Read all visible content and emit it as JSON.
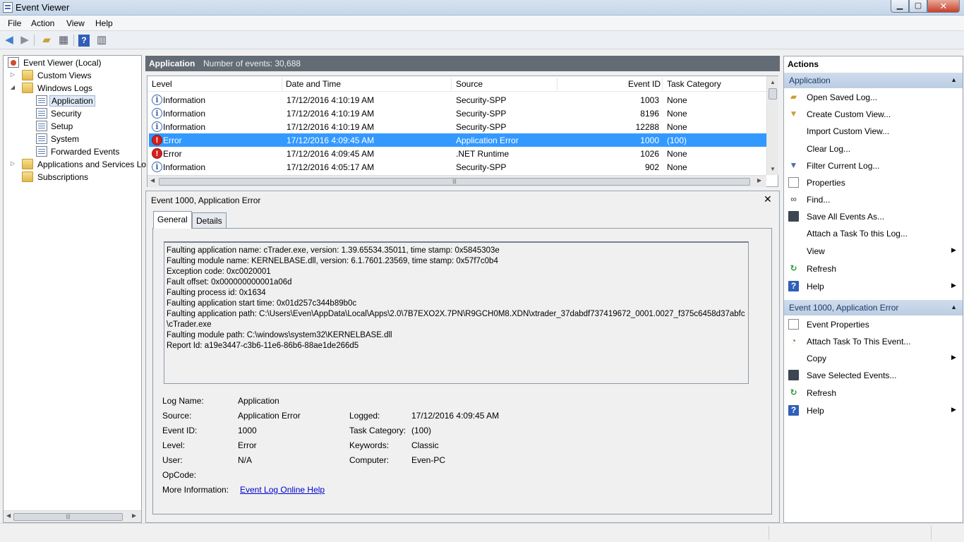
{
  "window": {
    "title": "Event Viewer"
  },
  "menu": [
    "File",
    "Action",
    "View",
    "Help"
  ],
  "tree": {
    "root": "Event Viewer (Local)",
    "custom_views": "Custom Views",
    "windows_logs": "Windows Logs",
    "logs": [
      "Application",
      "Security",
      "Setup",
      "System",
      "Forwarded Events"
    ],
    "apps_services": "Applications and Services Lo",
    "subscriptions": "Subscriptions"
  },
  "center": {
    "title": "Application",
    "count": "Number of events: 30,688"
  },
  "columns": [
    "Level",
    "Date and Time",
    "Source",
    "Event ID",
    "Task Category"
  ],
  "events": [
    {
      "level": "Information",
      "date": "17/12/2016 4:10:19 AM",
      "source": "Security-SPP",
      "id": "1003",
      "task": "None"
    },
    {
      "level": "Information",
      "date": "17/12/2016 4:10:19 AM",
      "source": "Security-SPP",
      "id": "8196",
      "task": "None"
    },
    {
      "level": "Information",
      "date": "17/12/2016 4:10:19 AM",
      "source": "Security-SPP",
      "id": "12288",
      "task": "None"
    },
    {
      "level": "Error",
      "date": "17/12/2016 4:09:45 AM",
      "source": "Application Error",
      "id": "1000",
      "task": "(100)"
    },
    {
      "level": "Error",
      "date": "17/12/2016 4:09:45 AM",
      "source": ".NET Runtime",
      "id": "1026",
      "task": "None"
    },
    {
      "level": "Information",
      "date": "17/12/2016 4:05:17 AM",
      "source": "Security-SPP",
      "id": "902",
      "task": "None"
    }
  ],
  "detail": {
    "title": "Event 1000, Application Error",
    "tabs": [
      "General",
      "Details"
    ],
    "message": [
      "Faulting application name: cTrader.exe, version: 1.39.65534.35011, time stamp: 0x5845303e",
      "Faulting module name: KERNELBASE.dll, version: 6.1.7601.23569, time stamp: 0x57f7c0b4",
      "Exception code: 0xc0020001",
      "Fault offset: 0x000000000001a06d",
      "Faulting process id: 0x1634",
      "Faulting application start time: 0x01d257c344b89b0c",
      "Faulting application path: C:\\Users\\Even\\AppData\\Local\\Apps\\2.0\\7B7EXO2X.7PN\\R9GCH0M8.XDN\\xtrader_37dabdf737419672_0001.0027_f375c6458d37abfc",
      "\\cTrader.exe",
      "Faulting module path: C:\\windows\\system32\\KERNELBASE.dll",
      "Report Id: a19e3447-c3b6-11e6-86b6-88ae1de266d5"
    ],
    "props": {
      "log_name_label": "Log Name:",
      "log_name": "Application",
      "source_label": "Source:",
      "source": "Application Error",
      "logged_label": "Logged:",
      "logged": "17/12/2016 4:09:45 AM",
      "event_id_label": "Event ID:",
      "event_id": "1000",
      "task_label": "Task Category:",
      "task": "(100)",
      "level_label": "Level:",
      "level": "Error",
      "keywords_label": "Keywords:",
      "keywords": "Classic",
      "user_label": "User:",
      "user": "N/A",
      "computer_label": "Computer:",
      "computer": "Even-PC",
      "opcode_label": "OpCode:",
      "more_info_label": "More Information:",
      "more_info_link": "Event Log Online Help"
    }
  },
  "actions": {
    "header": "Actions",
    "section1": "Application",
    "items1": [
      {
        "label": "Open Saved Log...",
        "icon": "folder-open-icon"
      },
      {
        "label": "Create Custom View...",
        "icon": "filter-icon"
      },
      {
        "label": "Import Custom View...",
        "icon": ""
      },
      {
        "label": "Clear Log...",
        "icon": ""
      },
      {
        "label": "Filter Current Log...",
        "icon": "filter-icon"
      },
      {
        "label": "Properties",
        "icon": "properties-icon"
      },
      {
        "label": "Find...",
        "icon": "binoculars-icon"
      },
      {
        "label": "Save All Events As...",
        "icon": "save-icon"
      },
      {
        "label": "Attach a Task To this Log...",
        "icon": ""
      },
      {
        "label": "View",
        "icon": "",
        "submenu": true
      },
      {
        "label": "Refresh",
        "icon": "refresh-icon"
      },
      {
        "label": "Help",
        "icon": "help-icon",
        "submenu": true
      }
    ],
    "section2": "Event 1000, Application Error",
    "items2": [
      {
        "label": "Event Properties",
        "icon": "properties-icon"
      },
      {
        "label": "Attach Task To This Event...",
        "icon": "task-icon"
      },
      {
        "label": "Copy",
        "icon": "copy-icon",
        "submenu": true
      },
      {
        "label": "Save Selected Events...",
        "icon": "save-icon"
      },
      {
        "label": "Refresh",
        "icon": "refresh-icon"
      },
      {
        "label": "Help",
        "icon": "help-icon",
        "submenu": true
      }
    ]
  }
}
